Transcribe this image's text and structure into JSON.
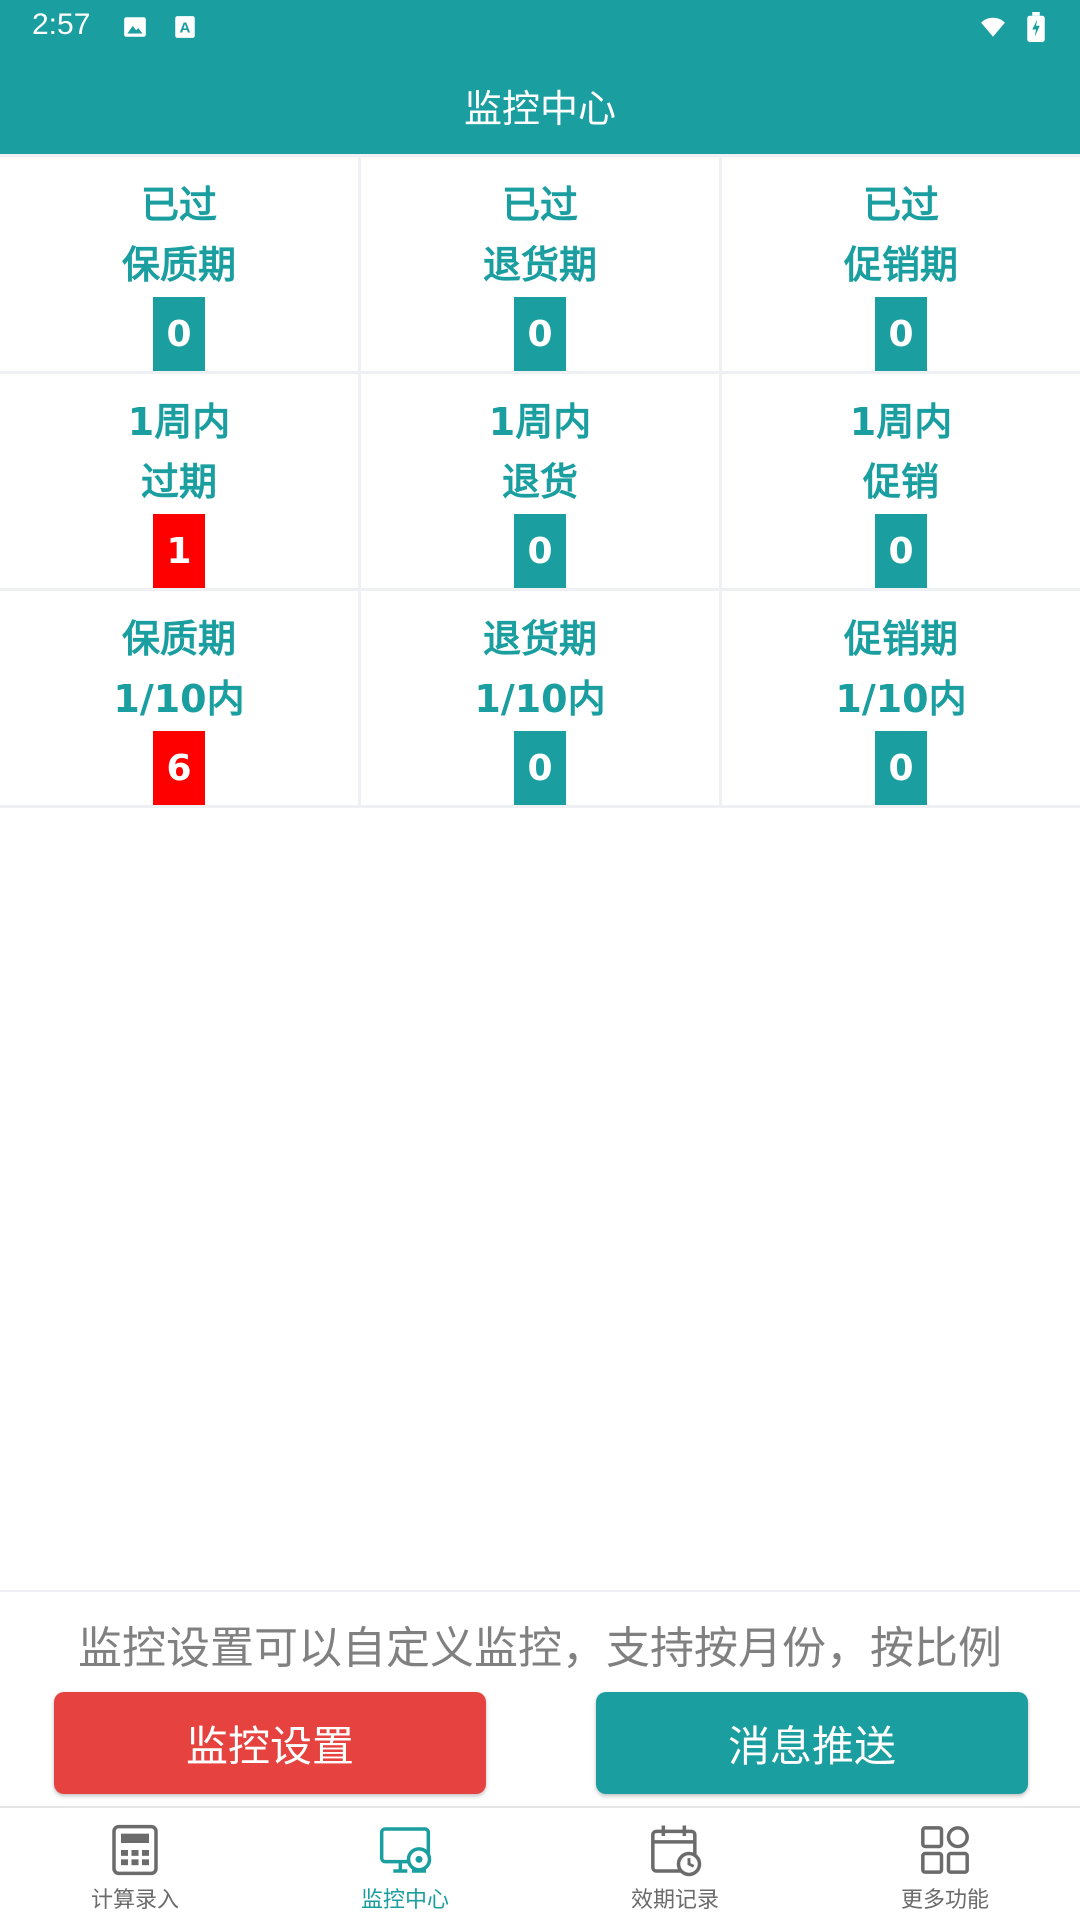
{
  "status_bar": {
    "time": "2:57"
  },
  "header": {
    "title": "监控中心"
  },
  "colors": {
    "primary": "#1a9e9f",
    "alert": "#ff0000",
    "danger_button": "#e64340",
    "grid_bg": "#eef0f4"
  },
  "grid": {
    "cells": [
      {
        "line1": "已过",
        "line2": "保质期",
        "count": "0",
        "alert": false
      },
      {
        "line1": "已过",
        "line2": "退货期",
        "count": "0",
        "alert": false
      },
      {
        "line1": "已过",
        "line2": "促销期",
        "count": "0",
        "alert": false
      },
      {
        "line1": "1周内",
        "line2": "过期",
        "count": "1",
        "alert": true
      },
      {
        "line1": "1周内",
        "line2": "退货",
        "count": "0",
        "alert": false
      },
      {
        "line1": "1周内",
        "line2": "促销",
        "count": "0",
        "alert": false
      },
      {
        "line1": "保质期",
        "line2": "1/10内",
        "count": "6",
        "alert": true
      },
      {
        "line1": "退货期",
        "line2": "1/10内",
        "count": "0",
        "alert": false
      },
      {
        "line1": "促销期",
        "line2": "1/10内",
        "count": "0",
        "alert": false
      }
    ]
  },
  "info": {
    "text": "监控设置可以自定义监控，支持按月份，按比例"
  },
  "buttons": {
    "settings": "监控设置",
    "push": "消息推送"
  },
  "nav": {
    "items": [
      {
        "label": "计算录入",
        "icon": "calculator-icon",
        "active": false
      },
      {
        "label": "监控中心",
        "icon": "monitor-icon",
        "active": true
      },
      {
        "label": "效期记录",
        "icon": "calendar-clock-icon",
        "active": false
      },
      {
        "label": "更多功能",
        "icon": "grid-apps-icon",
        "active": false
      }
    ]
  }
}
